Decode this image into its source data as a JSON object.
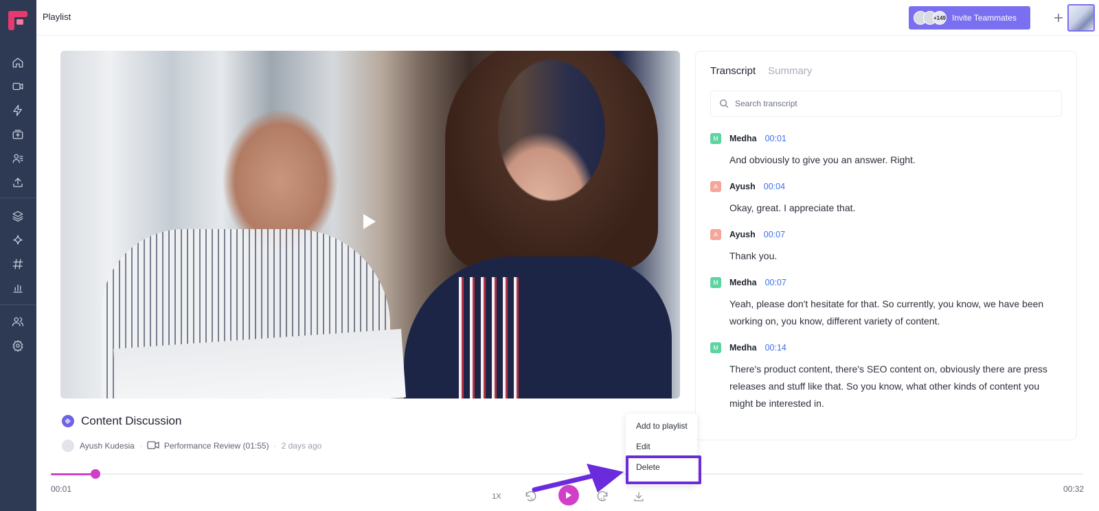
{
  "header": {
    "page_title": "Playlist",
    "invite_label": "Invite Teammates",
    "member_count": "+149",
    "add_icon": "plus-icon",
    "brand_color": "#7a6ff0"
  },
  "sidebar": {
    "items": [
      {
        "name": "home",
        "icon": "home-icon"
      },
      {
        "name": "recordings",
        "icon": "video-icon"
      },
      {
        "name": "quick-actions",
        "icon": "lightning-icon"
      },
      {
        "name": "library",
        "icon": "inbox-icon"
      },
      {
        "name": "contacts",
        "icon": "user-list-icon"
      },
      {
        "name": "upload",
        "icon": "upload-icon"
      },
      {
        "name": "layers",
        "icon": "layers-icon"
      },
      {
        "name": "ai",
        "icon": "sparkle-icon"
      },
      {
        "name": "topics",
        "icon": "hash-icon"
      },
      {
        "name": "analytics",
        "icon": "bar-chart-icon"
      },
      {
        "name": "team",
        "icon": "users-icon"
      },
      {
        "name": "settings",
        "icon": "gear-icon"
      }
    ]
  },
  "video": {
    "title": "Content Discussion",
    "owner": "Ayush Kudesia",
    "source": "Performance Review (01:55)",
    "age": "2 days ago"
  },
  "panel": {
    "tabs": [
      {
        "label": "Transcript",
        "active": true
      },
      {
        "label": "Summary",
        "active": false
      }
    ],
    "search_placeholder": "Search transcript",
    "entries": [
      {
        "initial": "M",
        "speaker": "Medha",
        "time": "00:01",
        "text": "And obviously to give you an answer. Right."
      },
      {
        "initial": "A",
        "speaker": "Ayush",
        "time": "00:04",
        "text": "Okay, great. I appreciate that."
      },
      {
        "initial": "A",
        "speaker": "Ayush",
        "time": "00:07",
        "text": "Thank you."
      },
      {
        "initial": "M",
        "speaker": "Medha",
        "time": "00:07",
        "text": "Yeah, please don't hesitate for that. So currently, you know, we have been working on, you know, different variety of content."
      },
      {
        "initial": "M",
        "speaker": "Medha",
        "time": "00:14",
        "text": "There's product content, there's SEO content on, obviously there are press releases and stuff like that. So you know, what other kinds of content you might be interested in."
      }
    ]
  },
  "menu": {
    "items": [
      "Add to playlist",
      "Edit",
      "Delete"
    ],
    "highlighted": "Delete",
    "highlight_color": "#6a2bdc"
  },
  "player": {
    "current_time": "00:01",
    "total_time": "00:32",
    "speed": "1X",
    "rewind_seconds": "5",
    "forward_seconds": "15",
    "progress_fraction": 0.043,
    "accent_color": "#d13fc7"
  }
}
